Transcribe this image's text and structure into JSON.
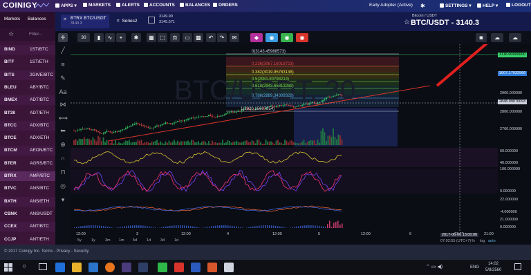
{
  "nav": {
    "logo": "COINIGY",
    "items": [
      "APPS",
      "MARKETS",
      "ALERTS",
      "ACCOUNTS",
      "BALANCES",
      "ORDERS"
    ],
    "status": "Early Adopter (Active)",
    "right": [
      "SETTINGS",
      "HELP",
      "LOGOUT"
    ]
  },
  "sidebar": {
    "tabs": [
      "Markets",
      "Balances"
    ],
    "filter_placeholder": "Filter...",
    "markets": [
      {
        "a": "BIND",
        "b": "1ST/BTC"
      },
      {
        "a": "BITF",
        "b": "1ST/ETH"
      },
      {
        "a": "BITS",
        "b": "2GIVE/BTC"
      },
      {
        "a": "BLEU",
        "b": "ABY/BTC"
      },
      {
        "a": "BMEX",
        "b": "ADT/BTC"
      },
      {
        "a": "BT38",
        "b": "ADT/ETH"
      },
      {
        "a": "BTCC",
        "b": "ADX/BTC"
      },
      {
        "a": "BTCE",
        "b": "ADX/ETH"
      },
      {
        "a": "BTCM",
        "b": "AEON/BTC"
      },
      {
        "a": "BTER",
        "b": "AGRS/BTC"
      },
      {
        "a": "BTRX",
        "b": "AMP/BTC"
      },
      {
        "a": "BTVC",
        "b": "ANS/BTC"
      },
      {
        "a": "BXTH",
        "b": "ANS/ETH"
      },
      {
        "a": "CBNK",
        "b": "ANS/USDT"
      },
      {
        "a": "CCEX",
        "b": "ANT/BTC"
      },
      {
        "a": "CCJP",
        "b": "ANT/ETH"
      }
    ]
  },
  "header": {
    "market_tab": "BTRX BTC/USDT",
    "market_tab_price": "3140.3",
    "series_tab": "Series2",
    "stat1": "3149.99",
    "stat2": "3145.571",
    "pair_sub": "Bitcoin / USDT",
    "pair_title": "BTC/USDT - 3140.3"
  },
  "toolbar": {
    "interval": "30"
  },
  "chart_overlay": {
    "fib": [
      {
        "label": "0(3143.45988573)",
        "color": "#cfd3e0"
      },
      {
        "label": "0.236(3067.16018723)",
        "color": "#e34848"
      },
      {
        "label": "0.382(3019.95783138)",
        "color": "#e6e24a"
      },
      {
        "label": "0.5(2981.80798214)",
        "color": "#7ad94f"
      },
      {
        "label": "0.618(2943.65813289)",
        "color": "#7ad94f"
      },
      {
        "label": "0.786(2889.34309328)",
        "color": "#5fb4e6"
      },
      {
        "label": "1(2820.15607854)",
        "color": "#cfd3e0"
      }
    ],
    "watermark": "BTC/USDT, 30"
  },
  "axis": {
    "badges": [
      {
        "v": "3118.00000000",
        "color": "#37d16a"
      },
      {
        "v": "3007.17032966",
        "color": "#2f7bd9"
      },
      {
        "v": "2848.99070093",
        "color": "#cfd3e0"
      }
    ],
    "labels": [
      "2900.000000",
      "2800.000000",
      "2700.000000",
      "60.000000",
      "40.000000",
      "100.000000",
      "0.000000",
      "22.000000",
      "-4.000000",
      "21.000000",
      "0.000000"
    ]
  },
  "timeaxis": {
    "labels": [
      "12:00",
      "3",
      "12:00",
      "4",
      "12:00",
      "5",
      "12:00",
      "6",
      "12:00",
      "21:00"
    ],
    "ranges": [
      "5y",
      "1y",
      "3m",
      "1m",
      "5d",
      "1d",
      "3d",
      "1d"
    ],
    "current": "2017-06-06 13:00:00",
    "clock": "07:02:55 (UTC+7)",
    "scale": [
      "%",
      "log",
      "auto"
    ]
  },
  "footer": {
    "text": "© 2017 Coinigy Inc. Terms - Privacy - Security"
  },
  "taskbar": {
    "time": "14:02",
    "date": "5/8/2560",
    "lang": "ENG"
  }
}
